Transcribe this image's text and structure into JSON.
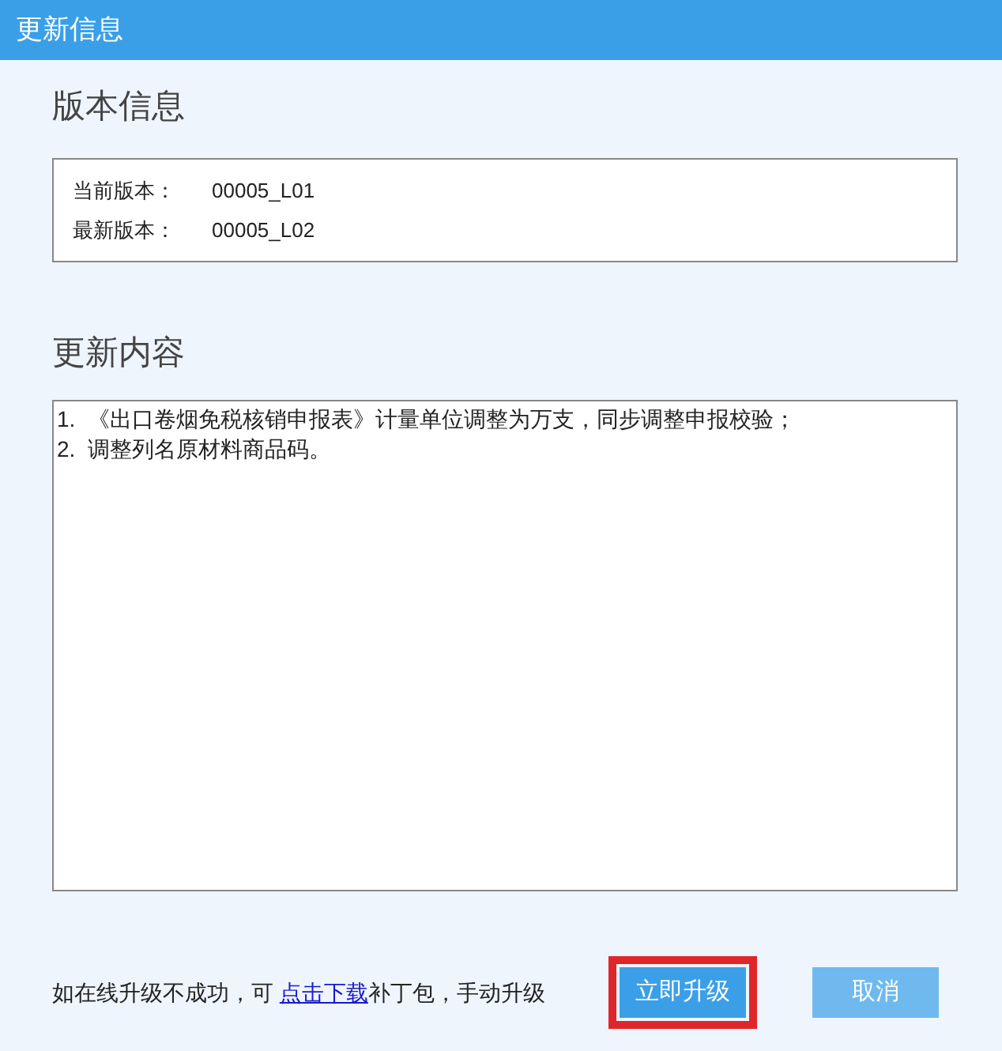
{
  "window": {
    "title": "更新信息"
  },
  "version_section": {
    "heading": "版本信息",
    "rows": [
      {
        "label": "当前版本：",
        "value": "00005_L01"
      },
      {
        "label": "最新版本：",
        "value": "00005_L02"
      }
    ]
  },
  "content_section": {
    "heading": "更新内容",
    "lines": [
      "1.  《出口卷烟免税核销申报表》计量单位调整为万支，同步调整申报校验；",
      "2.  调整列名原材料商品码。"
    ]
  },
  "footer": {
    "note_before": "如在线升级不成功，可 ",
    "link": "点击下载",
    "note_after": "补丁包，手动升级",
    "buttons": [
      {
        "label": "立即升级",
        "highlighted": true
      },
      {
        "label": "取消",
        "highlighted": false
      }
    ]
  }
}
